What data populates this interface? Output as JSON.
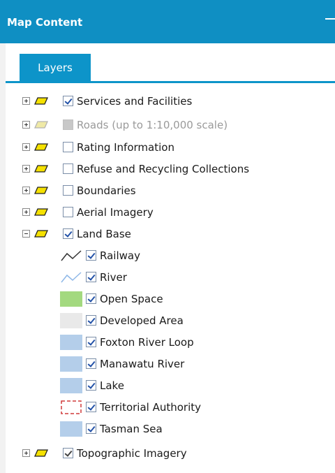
{
  "header": {
    "title": "Map Content"
  },
  "tabs": [
    {
      "label": "Layers"
    }
  ],
  "layers": [
    {
      "label": "Services and Facilities",
      "checked": true
    },
    {
      "label": "Roads (up to 1:10,000 scale)",
      "checked": false,
      "disabled": true
    },
    {
      "label": "Rating Information",
      "checked": false
    },
    {
      "label": "Refuse and Recycling Collections",
      "checked": false
    },
    {
      "label": "Boundaries",
      "checked": false
    },
    {
      "label": "Aerial Imagery",
      "checked": false
    },
    {
      "label": "Land Base",
      "checked": true,
      "expanded": true
    },
    {
      "label": "Topographic Imagery",
      "checked": true
    }
  ],
  "land_base_children": [
    {
      "label": "Railway",
      "symbol": "railway-line-icon",
      "checked": true
    },
    {
      "label": "River",
      "symbol": "river-line-icon",
      "checked": true,
      "color": "#8fb8e8"
    },
    {
      "label": "Open Space",
      "symbol": "fill-swatch",
      "checked": true,
      "color": "#a3d97f"
    },
    {
      "label": "Developed Area",
      "symbol": "fill-swatch",
      "checked": true,
      "color": "#e9e9e9"
    },
    {
      "label": "Foxton River Loop",
      "symbol": "fill-swatch",
      "checked": true,
      "color": "#b4ceea"
    },
    {
      "label": "Manawatu River",
      "symbol": "fill-swatch",
      "checked": true,
      "color": "#b4ceea"
    },
    {
      "label": "Lake",
      "symbol": "fill-swatch",
      "checked": true,
      "color": "#b4ceea"
    },
    {
      "label": "Territorial Authority",
      "symbol": "dashed-outline-icon",
      "checked": true,
      "color": "#d03a3a"
    },
    {
      "label": "Tasman Sea",
      "symbol": "fill-swatch",
      "checked": true,
      "color": "#b4ceea"
    }
  ],
  "colors": {
    "accent": "#0f8fc3",
    "layer_icon": "#f5e100"
  }
}
